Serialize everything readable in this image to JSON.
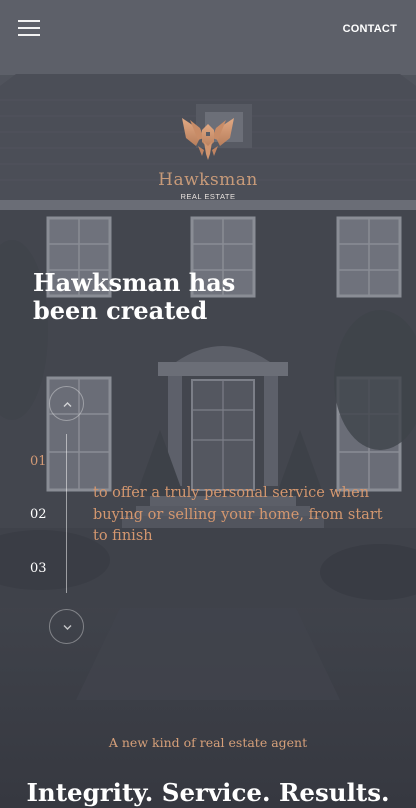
{
  "nav": {
    "menu_icon": "hamburger-menu-icon",
    "contact_label": "CONTACT"
  },
  "logo": {
    "icon": "hawk-emblem-icon",
    "name": "Hawksman",
    "subtitle": "REAL ESTATE"
  },
  "hero": {
    "headline": "Hawksman has been created",
    "slider": {
      "up_icon": "chevron-up-icon",
      "down_icon": "chevron-down-icon",
      "steps": [
        "01",
        "02",
        "03"
      ],
      "active_step": "01",
      "text": "to offer a truly personal service when buying or selling your home, from start to finish"
    }
  },
  "intro": {
    "tagline": "A new kind of real estate agent",
    "motto": "Integrity. Service. Results."
  },
  "colors": {
    "accent": "#d39a76",
    "overlay": "#4a4d56"
  }
}
